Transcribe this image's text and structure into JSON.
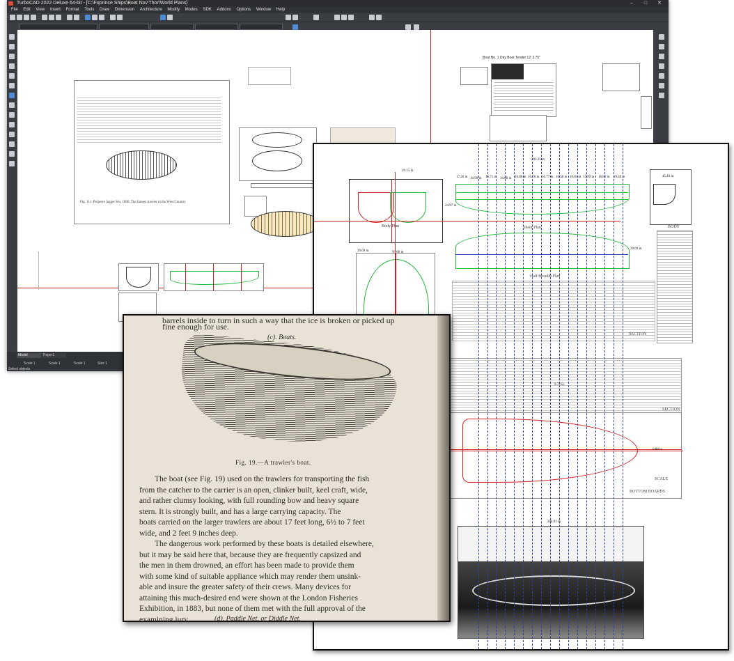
{
  "app": {
    "title": "TurboCAD 2022 Deluxe 64-bit - [C:\\Fqorince Ships\\Boat Nov'Thor\\World Plans]",
    "menu": [
      "File",
      "Edit",
      "View",
      "Insert",
      "Format",
      "Tools",
      "Draw",
      "Dimension",
      "Architecture",
      "Modify",
      "Modes",
      "SDK",
      "Addons",
      "Options",
      "Window",
      "Help"
    ],
    "window_controls": [
      "–",
      "□",
      "✕"
    ],
    "status_tabs": [
      "Model",
      "Paper1"
    ],
    "status_fields": [
      "Scale 1",
      "Scale 1",
      "Scale 1",
      "Size 1"
    ],
    "status_text": "Select objects"
  },
  "cad_canvas": {
    "caption_lugger": "Fig. 111.  Polperro lugger Iris, 1898.   The famest trawler in the West Country",
    "upper_right_title": "Boat No. 1 Day Boat Tender 12' 2.75\""
  },
  "drawing": {
    "overall_length": "203.25 in",
    "stations": [
      "17.26 in",
      "16.90 in",
      "16.71 in",
      "16.80 in",
      "16.80 in",
      "16.76 in",
      "16.77 in",
      "16.58 in",
      "16.81 in",
      "15.99 in",
      "16.82 in",
      "19.40 in"
    ],
    "body_plan_width": "39.15 in",
    "body_plan_label": "Body Plan",
    "sheer_height": "24.97 in",
    "body_right_width": "45.16 in",
    "body_right_label": "BODY",
    "sheer_plan_label": "Sheer Plan",
    "sheer_depth": "39.69 in",
    "half_breadth_label": "Half Breadth Plan",
    "half_breadth_width": "39.69 in",
    "lower_width": "99.60 in",
    "section_label": "SECTION",
    "keel_label": "BOTTOM BOARDS",
    "mid_dim": "9.72 in",
    "transom_dim": "0.88 in",
    "photo_width": "204.01 in",
    "scale_label": "SCALE"
  },
  "book": {
    "top_text_1": "barrels inside to turn in such a way that the ice is broken or picked up",
    "top_text_2": "fine enough for use.",
    "section_heading": "(c). Boats.",
    "figure_caption": "Fig. 19.—A trawler's boat.",
    "paragraphs": [
      "The boat (see Fig. 19) used on the trawlers for transporting the fish",
      "from the catcher to the carrier is an open, clinker built, keel craft, wide,",
      "and rather clumsy looking, with full rounding bow and heavy square",
      "stern.  It is strongly built, and has a large carrying capacity.  The",
      "boats carried on the larger trawlers are about 17 feet long, 6½ to 7 feet",
      "wide, and 2 feet 9 inches deep.",
      "The dangerous work performed by these boats is detailed elsewhere,",
      "but it may be said here that, because they are frequently capsized and",
      "the men in them drowned, an effort has been made to provide them",
      "with some kind of suitable appliance which may render them unsink-",
      "able and insure the greater safety of their crews.  Many devices for",
      "attaining this much-desired end were shown at the London Fisheries",
      "Exhibition, in 1883, but none of them met with the full approval of the",
      "examining jury."
    ],
    "bottom_text": "(d). Paddle Net, or Diddle Net."
  },
  "colors": {
    "cad_dark": "#3c3f44",
    "accent_red": "#d12020",
    "station_blue": "#2a3fa8",
    "waterline_green": "#1fb83a",
    "paper": "#e8e3d6"
  }
}
